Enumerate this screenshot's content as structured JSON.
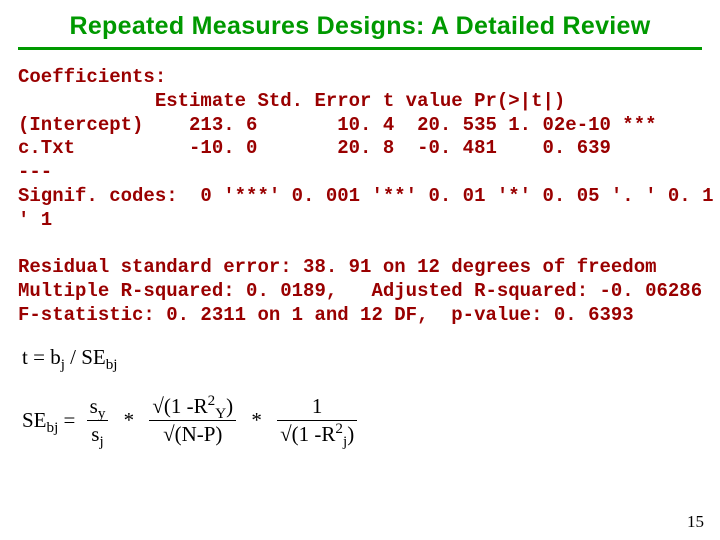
{
  "title": "Repeated Measures Designs: A Detailed Review",
  "code_block": "Coefficients:\n            Estimate Std. Error t value Pr(>|t|)\n(Intercept)    213. 6       10. 4  20. 535 1. 02e-10 ***\nc.Txt          -10. 0       20. 8  -0. 481    0. 639\n---\nSignif. codes:  0 '***' 0. 001 '**' 0. 01 '*' 0. 05 '. ' 0. 1 '\n' 1\n\nResidual standard error: 38. 91 on 12 degrees of freedom\nMultiple R-squared: 0. 0189,   Adjusted R-squared: -0. 06286\nF-statistic: 0. 2311 on 1 and 12 DF,  p-value: 0. 6393",
  "formula1": {
    "lhs": "t  =  ",
    "rhs_base": "b",
    "rhs_sub": "j",
    "div": " / ",
    "se": "SE",
    "se_sub": "bj"
  },
  "formula2": {
    "lhs": "SE",
    "lhs_sub": "bj",
    "eq": "   =  ",
    "frac1_top": "s",
    "frac1_top_sub": "y",
    "frac1_bot": "s",
    "frac1_bot_sub": "j",
    "mul": "*",
    "frac2_top_pre": "√(1 -R",
    "frac2_top_sup": "2",
    "frac2_top_sub": "Y",
    "frac2_top_post": ")",
    "frac2_bot": "√(N-P)",
    "frac3_top": "1",
    "frac3_bot_pre": "√(1 -R",
    "frac3_bot_sup": "2",
    "frac3_bot_sub": "j",
    "frac3_bot_post": ")"
  },
  "pagenum": "15"
}
